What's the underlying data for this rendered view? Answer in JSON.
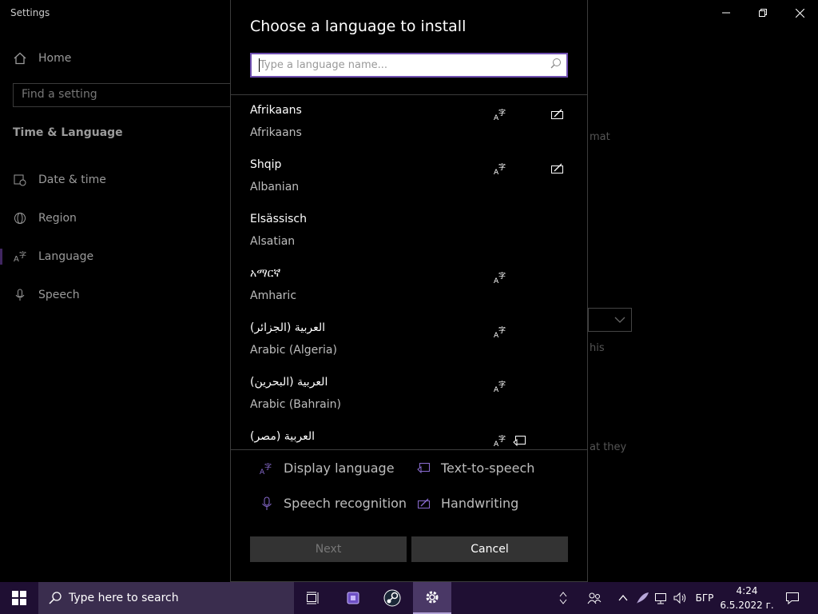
{
  "app": {
    "title": "Settings"
  },
  "sidebar": {
    "home": "Home",
    "find_placeholder": "Find a setting",
    "section_title": "Time & Language",
    "items": [
      {
        "label": "Date & time",
        "icon": "calendar-clock-icon"
      },
      {
        "label": "Region",
        "icon": "globe-icon"
      },
      {
        "label": "Language",
        "icon": "language-icon"
      },
      {
        "label": "Speech",
        "icon": "microphone-icon"
      }
    ]
  },
  "background": {
    "text1": "mat",
    "text2": "his",
    "text3": "at they"
  },
  "dialog": {
    "title": "Choose a language to install",
    "search_placeholder": "Type a language name...",
    "languages": [
      {
        "native": "Afrikaans",
        "english": "Afrikaans",
        "features": [
          "display",
          "handwriting"
        ]
      },
      {
        "native": "Shqip",
        "english": "Albanian",
        "features": [
          "display",
          "handwriting"
        ]
      },
      {
        "native": "Elsässisch",
        "english": "Alsatian",
        "features": []
      },
      {
        "native": "አማርኛ",
        "english": "Amharic",
        "features": [
          "display"
        ]
      },
      {
        "native": "العربية (الجزائر)",
        "english": "Arabic (Algeria)",
        "features": [
          "display"
        ]
      },
      {
        "native": "العربية (البحرين)",
        "english": "Arabic (Bahrain)",
        "features": [
          "display"
        ]
      },
      {
        "native": "العربية (مصر)",
        "english": "",
        "features": [
          "display",
          "tts"
        ]
      }
    ],
    "legend": {
      "display": "Display language",
      "tts": "Text-to-speech",
      "speech": "Speech recognition",
      "handwriting": "Handwriting"
    },
    "next": "Next",
    "cancel": "Cancel"
  },
  "taskbar": {
    "search_placeholder": "Type here to search",
    "language_indicator": "БГР",
    "time": "4:24",
    "date": "6.5.2022 г."
  },
  "colors": {
    "accent": "#8a6cd1",
    "taskbar": "#1f0f33"
  }
}
